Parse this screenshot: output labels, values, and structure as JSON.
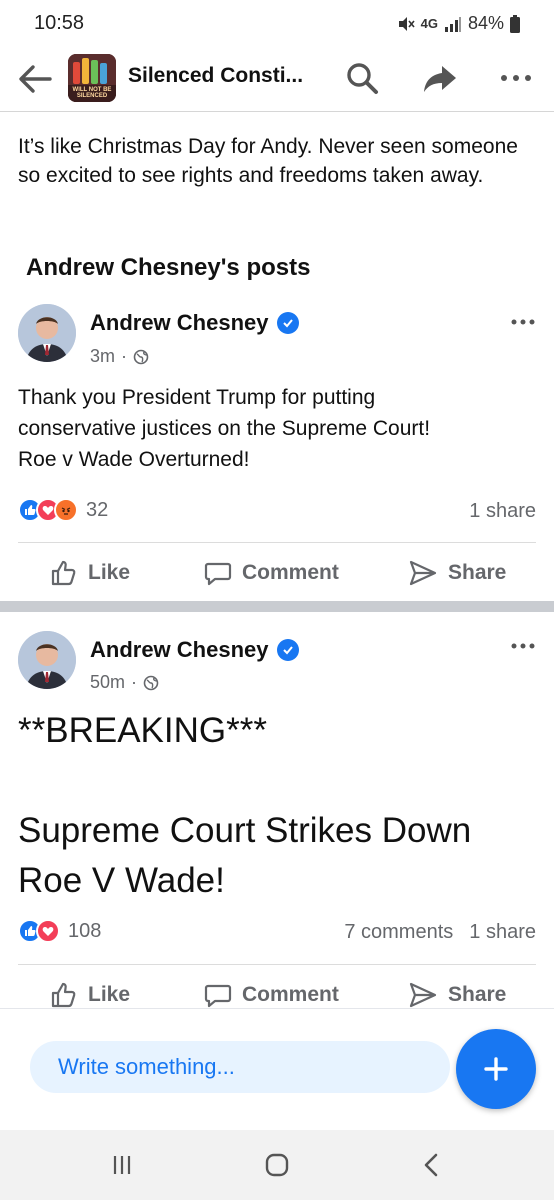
{
  "status_bar": {
    "time": "10:58",
    "network": "4G",
    "battery": "84%"
  },
  "app_bar": {
    "title": "Silenced Consti...",
    "logo_text": "WILL NOT BE SILENCED"
  },
  "intro_text": "It’s like Christmas Day for Andy. Never seen someone so excited to see rights and freedoms taken away.",
  "section_heading": "Andrew Chesney's posts",
  "posts": [
    {
      "author": "Andrew Chesney",
      "time": "3m",
      "body_lines": [
        "Thank you President Trump for putting",
        "conservative justices on the Supreme Court!",
        "Roe v Wade Overturned!"
      ],
      "reaction_icons": [
        "like",
        "love",
        "angry"
      ],
      "reaction_count": "32",
      "comments": "",
      "shares": "1 share"
    },
    {
      "author": "Andrew Chesney",
      "time": "50m",
      "body_lines": [
        "**BREAKING***",
        "",
        "Supreme Court Strikes Down",
        "Roe V Wade!"
      ],
      "reaction_icons": [
        "like",
        "love"
      ],
      "reaction_count": "108",
      "comments": "7 comments",
      "shares": "1 share"
    }
  ],
  "actions": {
    "like": "Like",
    "comment": "Comment",
    "share": "Share"
  },
  "composer": {
    "placeholder": "Write something..."
  },
  "colors": {
    "brand_blue": "#1877f2",
    "muted_text": "#65676b",
    "love_red": "#f33e58",
    "angry_orange": "#f7b125"
  },
  "icons": [
    "back-arrow-icon",
    "search-icon",
    "share-arrow-icon",
    "more-icon",
    "verified-badge-icon",
    "globe-icon",
    "like-icon",
    "comment-icon",
    "share-icon",
    "plus-icon",
    "recent-apps-icon",
    "home-icon",
    "back-icon"
  ]
}
